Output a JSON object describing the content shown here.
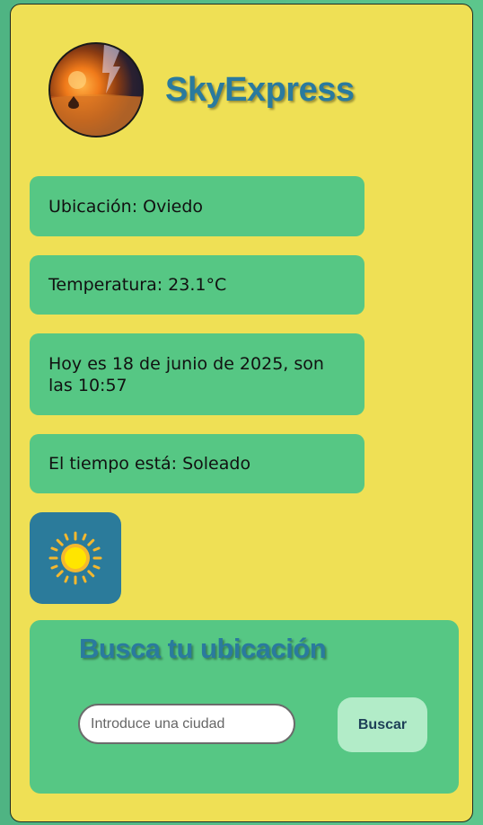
{
  "header": {
    "brand": "SkyExpress",
    "logo_icon": "storm-sunset-logo"
  },
  "info_cards": {
    "location": "Ubicación: Oviedo",
    "temperature": "Temperatura: 23.1°C",
    "datetime": "Hoy es 18 de junio de 2025, son las 10:57",
    "condition": "El tiempo está: Soleado"
  },
  "weather_icon": "sun-icon",
  "search": {
    "title": "Busca tu ubicación",
    "placeholder": "Introduce una ciudad",
    "value": "",
    "button_label": "Buscar"
  },
  "colors": {
    "background": "#5cc68c",
    "panel": "#efe055",
    "card": "#56c784",
    "accent": "#2a7a9e",
    "button": "#b2ecc8"
  }
}
